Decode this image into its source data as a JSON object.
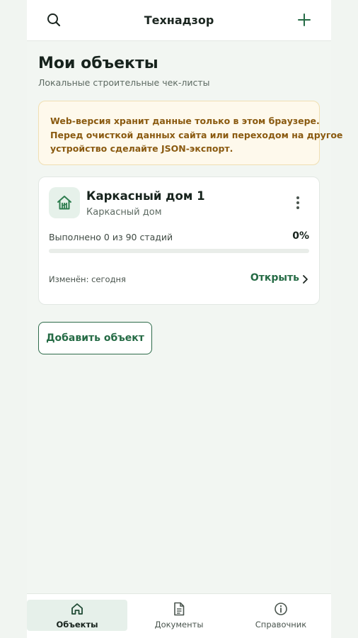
{
  "header": {
    "title": "Технадзор",
    "search_icon": "search-icon",
    "add_icon": "plus-icon"
  },
  "page": {
    "title": "Мои объекты",
    "subtitle": "Локальные строительные чек-листы"
  },
  "notice": {
    "lines": [
      "Web-версия хранит данные только в этом браузере.",
      "Перед очисткой данных сайта или переходом на другое",
      "устройство сделайте JSON-экспорт."
    ]
  },
  "objects": [
    {
      "name": "Каркасный дом 1",
      "type": "Каркасный дом",
      "icon": "house-icon",
      "progress_text": "Выполнено 0 из 90 стадий",
      "progress_percent": "0%",
      "progress_value": 0,
      "modified": "Изменён: сегодня",
      "open_label": "Открыть"
    }
  ],
  "actions": {
    "add_object_label": "Добавить объект"
  },
  "bottom_nav": {
    "items": [
      {
        "label": "Объекты",
        "icon": "home-icon",
        "active": true
      },
      {
        "label": "Документы",
        "icon": "document-icon",
        "active": false
      },
      {
        "label": "Справочник",
        "icon": "info-icon",
        "active": false
      }
    ]
  },
  "colors": {
    "accent": "#256b45",
    "background": "#f2f6f2",
    "notice_bg": "#fef9ec",
    "notice_text": "#8a5a10"
  }
}
